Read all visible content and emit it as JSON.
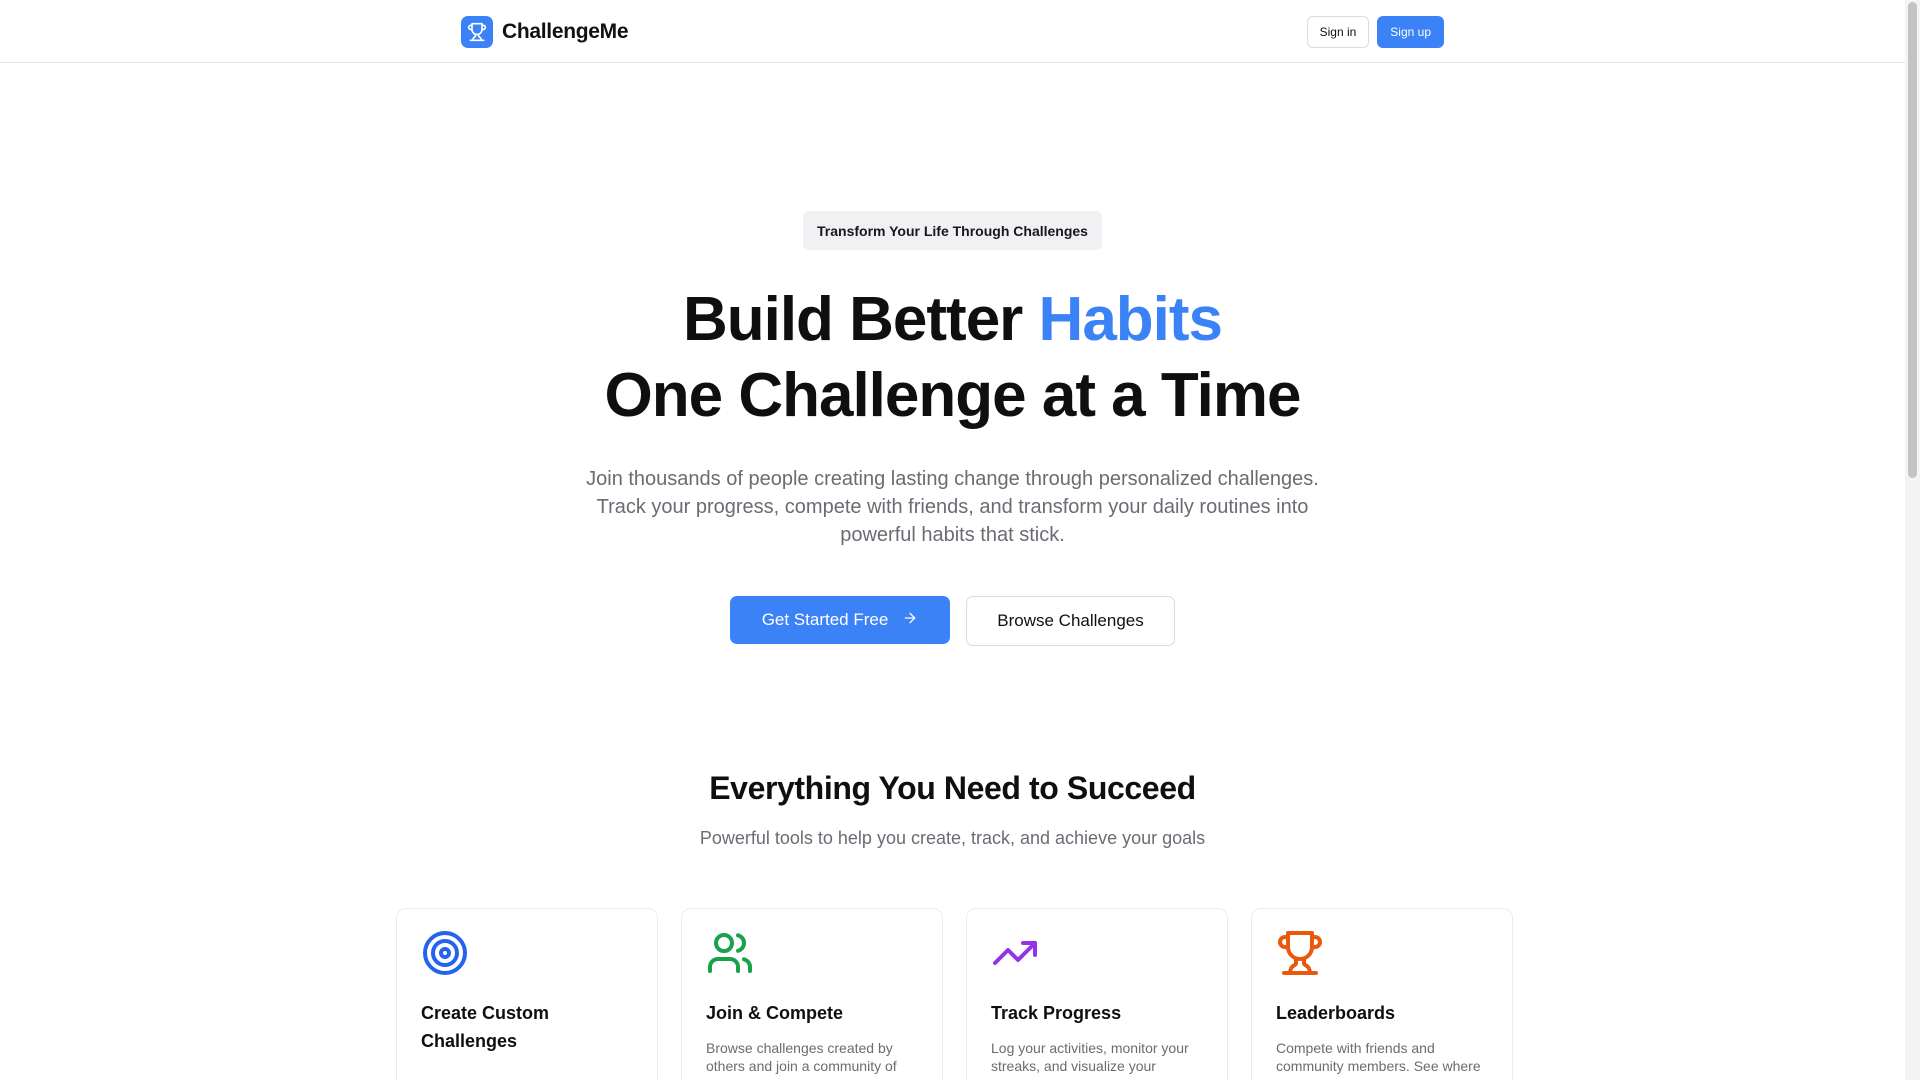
{
  "brand": {
    "name": "ChallengeMe",
    "logo_icon": "trophy-icon",
    "accent_color": "#3b82f6"
  },
  "header": {
    "sign_in_label": "Sign in",
    "sign_up_label": "Sign up"
  },
  "hero": {
    "badge": "Transform Your Life Through Challenges",
    "title_line1_prefix": "Build Better ",
    "title_line1_accent": "Habits",
    "title_line2": "One Challenge at a Time",
    "subtitle": "Join thousands of people creating lasting change through personalized challenges. Track your progress, compete with friends, and transform your daily routines into powerful habits that stick.",
    "primary_cta": "Get Started Free",
    "primary_cta_icon": "arrow-right-icon",
    "secondary_cta": "Browse Challenges"
  },
  "features": {
    "title": "Everything You Need to Succeed",
    "subtitle": "Powerful tools to help you create, track, and achieve your goals",
    "cards": [
      {
        "icon": "target-icon",
        "icon_color": "#2563eb",
        "title": "Create Custom Challenges",
        "description": ""
      },
      {
        "icon": "users-icon",
        "icon_color": "#16a34a",
        "title": "Join & Compete",
        "description": "Browse challenges created by others and join a community of"
      },
      {
        "icon": "trending-up-icon",
        "icon_color": "#9333ea",
        "title": "Track Progress",
        "description": "Log your activities, monitor your streaks, and visualize your"
      },
      {
        "icon": "trophy-icon",
        "icon_color": "#ea580c",
        "title": "Leaderboards",
        "description": "Compete with friends and community members. See where"
      }
    ]
  }
}
